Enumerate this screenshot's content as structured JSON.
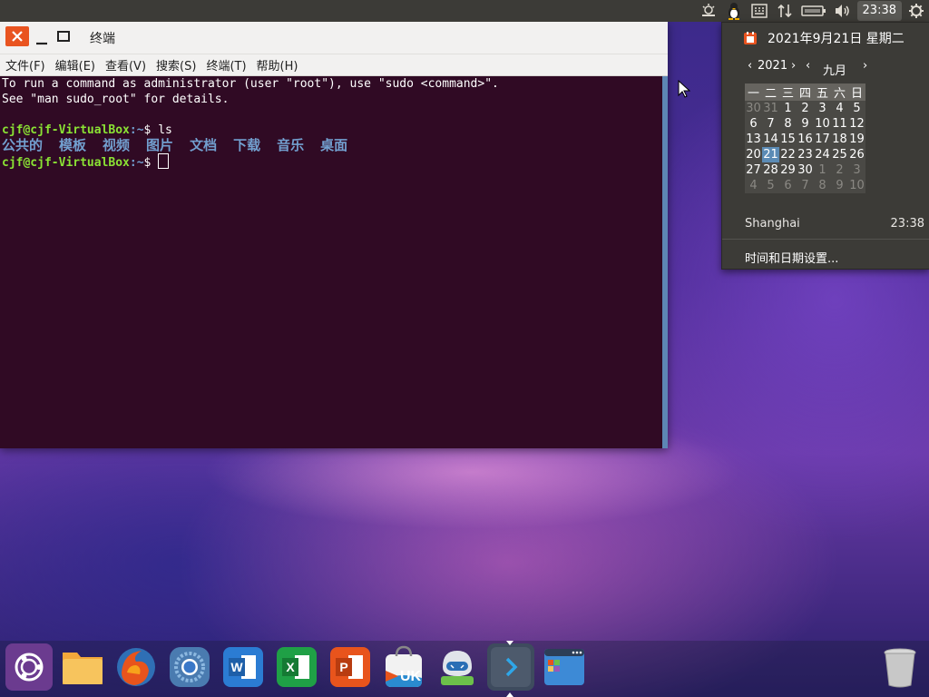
{
  "top_panel": {
    "clock": "23:38",
    "tray_icons": [
      "weather-icon",
      "penguin-icon",
      "keyboard-icon",
      "network-icon",
      "battery-icon",
      "volume-icon",
      "power-icon"
    ]
  },
  "terminal": {
    "title": "终端",
    "menu": [
      "文件(F)",
      "编辑(E)",
      "查看(V)",
      "搜索(S)",
      "终端(T)",
      "帮助(H)"
    ],
    "lines": {
      "l1": "To run a command as administrator (user \"root\"), use \"sudo <command>\".",
      "l2": "See \"man sudo_root\" for details."
    },
    "prompt_user": "cjf@cjf-VirtualBox",
    "prompt_path": ":~",
    "prompt_symbol": "$ ",
    "command": "ls",
    "dirs": [
      "公共的",
      "模板",
      "视频",
      "图片",
      "文档",
      "下载",
      "音乐",
      "桌面"
    ]
  },
  "calendar": {
    "date_text": "2021年9月21日 星期二",
    "year": "2021",
    "month": "九月",
    "weekdays": [
      "一",
      "二",
      "三",
      "四",
      "五",
      "六",
      "日"
    ],
    "weeks": [
      [
        "30",
        "31",
        "1",
        "2",
        "3",
        "4",
        "5"
      ],
      [
        "6",
        "7",
        "8",
        "9",
        "10",
        "11",
        "12"
      ],
      [
        "13",
        "14",
        "15",
        "16",
        "17",
        "18",
        "19"
      ],
      [
        "20",
        "21",
        "22",
        "23",
        "24",
        "25",
        "26"
      ],
      [
        "27",
        "28",
        "29",
        "30",
        "1",
        "2",
        "3"
      ],
      [
        "4",
        "5",
        "6",
        "7",
        "8",
        "9",
        "10"
      ]
    ],
    "today": "21",
    "city": "Shanghai",
    "city_time": "23:38",
    "settings_label": "时间和日期设置..."
  },
  "dock": {
    "items": [
      "dash-home",
      "files",
      "firefox",
      "chromium",
      "wps-writer",
      "wps-spreadsheets",
      "wps-presentation",
      "ubuntu-kylin-software",
      "kylin-assistant",
      "terminal",
      "workspace-switcher",
      "trash"
    ],
    "colors": {
      "wps_writer": "#2b7cd3",
      "wps_spreadsheets": "#1fa046",
      "wps_presentation": "#e8541c",
      "ubuntu_orange": "#e95420"
    },
    "uk_label": "UK"
  }
}
